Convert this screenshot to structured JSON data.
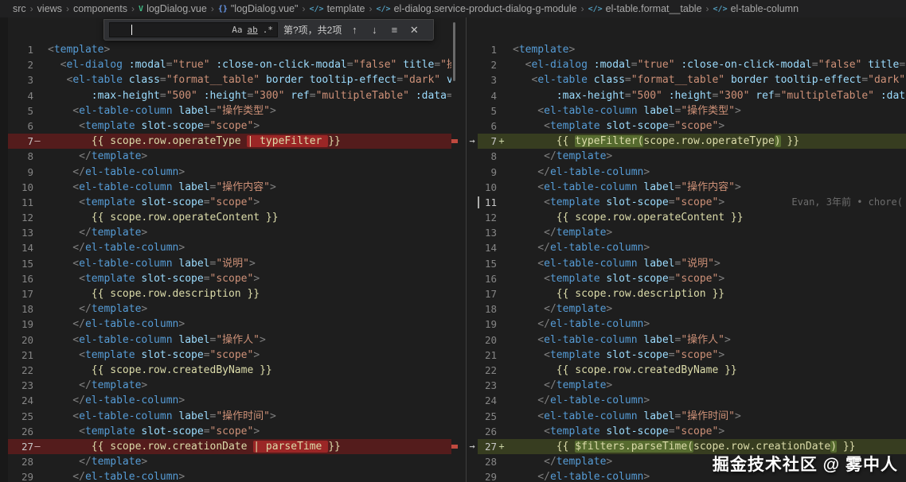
{
  "breadcrumb": {
    "separator": "›",
    "items": [
      {
        "label": "src",
        "icon": null
      },
      {
        "label": "views",
        "icon": null
      },
      {
        "label": "components",
        "icon": null
      },
      {
        "label": "logDialog.vue",
        "icon": "vue-icon"
      },
      {
        "label": "\"logDialog.vue\"",
        "icon": "braces-icon"
      },
      {
        "label": "template",
        "icon": "tag-icon"
      },
      {
        "label": "el-dialog.service-product-dialog-g-module",
        "icon": "tag-icon"
      },
      {
        "label": "el-table.format__table",
        "icon": "tag-icon"
      },
      {
        "label": "el-table-column",
        "icon": "tag-icon"
      }
    ]
  },
  "find_widget": {
    "input_value": "",
    "results_text": "第?项，共2项",
    "icons": {
      "match_case": "Aa",
      "whole_word": "ab",
      "regex": ".*",
      "prev": "↑",
      "next": "↓",
      "in_selection": "≡",
      "close": "✕"
    }
  },
  "colors": {
    "punct": "#808080",
    "tag": "#569cd6",
    "attr": "#9cdcfe",
    "string": "#ce9178",
    "expr": "#dcdcaa",
    "text": "#d4d4d4",
    "line_number": "#858585",
    "removed_line": "#541c1c",
    "removed_word": "#9b2626",
    "added_line": "#373d20",
    "added_word": "#566b2f"
  },
  "editor": {
    "cursor_line": 11,
    "diff_arrow": "→",
    "blame": {
      "line": 11,
      "text": "Evan, 3年前 • chore("
    },
    "lines": [
      {
        "n": 1,
        "segs": [
          [
            "p",
            "<"
          ],
          [
            "tag",
            "template"
          ],
          [
            "p",
            ">"
          ]
        ]
      },
      {
        "n": 2,
        "segs": [
          [
            "p",
            "  <"
          ],
          [
            "tag",
            "el-dialog"
          ],
          [
            "d",
            " "
          ],
          [
            "at",
            ":modal"
          ],
          [
            "p",
            "="
          ],
          [
            "st",
            "\"true\""
          ],
          [
            "d",
            " "
          ],
          [
            "at",
            ":close-on-click-modal"
          ],
          [
            "p",
            "="
          ],
          [
            "st",
            "\"false\""
          ],
          [
            "d",
            " "
          ],
          [
            "at",
            "title"
          ],
          [
            "p",
            "="
          ],
          [
            "st",
            "\"操"
          ]
        ]
      },
      {
        "n": 3,
        "segs": [
          [
            "p",
            "   <"
          ],
          [
            "tag",
            "el-table"
          ],
          [
            "d",
            " "
          ],
          [
            "at",
            "class"
          ],
          [
            "p",
            "="
          ],
          [
            "st",
            "\"format__table\""
          ],
          [
            "d",
            " "
          ],
          [
            "at",
            "border"
          ],
          [
            "d",
            " "
          ],
          [
            "at",
            "tooltip-effect"
          ],
          [
            "p",
            "="
          ],
          [
            "st",
            "\"dark\""
          ],
          [
            "d",
            " "
          ],
          [
            "at",
            "v-"
          ]
        ]
      },
      {
        "n": 4,
        "segs": [
          [
            "at",
            "       :max-height"
          ],
          [
            "p",
            "="
          ],
          [
            "st",
            "\"500\""
          ],
          [
            "d",
            " "
          ],
          [
            "at",
            ":height"
          ],
          [
            "p",
            "="
          ],
          [
            "st",
            "\"300\""
          ],
          [
            "d",
            " "
          ],
          [
            "at",
            "ref"
          ],
          [
            "p",
            "="
          ],
          [
            "st",
            "\"multipleTable\""
          ],
          [
            "d",
            " "
          ],
          [
            "at",
            ":data"
          ],
          [
            "p",
            "="
          ],
          [
            "st",
            "\""
          ]
        ]
      },
      {
        "n": 5,
        "segs": [
          [
            "p",
            "    <"
          ],
          [
            "tag",
            "el-table-column"
          ],
          [
            "d",
            " "
          ],
          [
            "at",
            "label"
          ],
          [
            "p",
            "="
          ],
          [
            "st",
            "\"操作类型\""
          ],
          [
            "p",
            ">"
          ]
        ]
      },
      {
        "n": 6,
        "segs": [
          [
            "p",
            "     <"
          ],
          [
            "tag",
            "template"
          ],
          [
            "d",
            " "
          ],
          [
            "at",
            "slot-scope"
          ],
          [
            "p",
            "="
          ],
          [
            "st",
            "\"scope\""
          ],
          [
            "p",
            ">"
          ]
        ]
      },
      {
        "n": 7,
        "left": {
          "type": "removed",
          "marker": "–",
          "segs": [
            [
              "ex",
              "       {{ scope.row.operateType "
            ],
            [
              "ex hr",
              "| typeFilter "
            ],
            [
              "ex",
              "}}"
            ]
          ]
        },
        "right": {
          "type": "added",
          "marker": "+",
          "arrow": true,
          "segs": [
            [
              "ex",
              "       {{ "
            ],
            [
              "ex hg",
              "typeFilter("
            ],
            [
              "ex",
              "scope.row.operateType"
            ],
            [
              "ex hg",
              ")"
            ],
            [
              "ex",
              " }}"
            ]
          ]
        }
      },
      {
        "n": 8,
        "segs": [
          [
            "p",
            "     </"
          ],
          [
            "tag",
            "template"
          ],
          [
            "p",
            ">"
          ]
        ]
      },
      {
        "n": 9,
        "segs": [
          [
            "p",
            "    </"
          ],
          [
            "tag",
            "el-table-column"
          ],
          [
            "p",
            ">"
          ]
        ]
      },
      {
        "n": 10,
        "segs": [
          [
            "p",
            "    <"
          ],
          [
            "tag",
            "el-table-column"
          ],
          [
            "d",
            " "
          ],
          [
            "at",
            "label"
          ],
          [
            "p",
            "="
          ],
          [
            "st",
            "\"操作内容\""
          ],
          [
            "p",
            ">"
          ]
        ]
      },
      {
        "n": 11,
        "segs": [
          [
            "p",
            "     <"
          ],
          [
            "tag",
            "template"
          ],
          [
            "d",
            " "
          ],
          [
            "at",
            "slot-scope"
          ],
          [
            "p",
            "="
          ],
          [
            "st",
            "\"scope\""
          ],
          [
            "p",
            ">"
          ]
        ]
      },
      {
        "n": 12,
        "segs": [
          [
            "ex",
            "       {{ scope.row.operateContent }}"
          ]
        ]
      },
      {
        "n": 13,
        "segs": [
          [
            "p",
            "     </"
          ],
          [
            "tag",
            "template"
          ],
          [
            "p",
            ">"
          ]
        ]
      },
      {
        "n": 14,
        "segs": [
          [
            "p",
            "    </"
          ],
          [
            "tag",
            "el-table-column"
          ],
          [
            "p",
            ">"
          ]
        ]
      },
      {
        "n": 15,
        "segs": [
          [
            "p",
            "    <"
          ],
          [
            "tag",
            "el-table-column"
          ],
          [
            "d",
            " "
          ],
          [
            "at",
            "label"
          ],
          [
            "p",
            "="
          ],
          [
            "st",
            "\"说明\""
          ],
          [
            "p",
            ">"
          ]
        ]
      },
      {
        "n": 16,
        "segs": [
          [
            "p",
            "     <"
          ],
          [
            "tag",
            "template"
          ],
          [
            "d",
            " "
          ],
          [
            "at",
            "slot-scope"
          ],
          [
            "p",
            "="
          ],
          [
            "st",
            "\"scope\""
          ],
          [
            "p",
            ">"
          ]
        ]
      },
      {
        "n": 17,
        "segs": [
          [
            "ex",
            "       {{ scope.row.description }}"
          ]
        ]
      },
      {
        "n": 18,
        "segs": [
          [
            "p",
            "     </"
          ],
          [
            "tag",
            "template"
          ],
          [
            "p",
            ">"
          ]
        ]
      },
      {
        "n": 19,
        "segs": [
          [
            "p",
            "    </"
          ],
          [
            "tag",
            "el-table-column"
          ],
          [
            "p",
            ">"
          ]
        ]
      },
      {
        "n": 20,
        "segs": [
          [
            "p",
            "    <"
          ],
          [
            "tag",
            "el-table-column"
          ],
          [
            "d",
            " "
          ],
          [
            "at",
            "label"
          ],
          [
            "p",
            "="
          ],
          [
            "st",
            "\"操作人\""
          ],
          [
            "p",
            ">"
          ]
        ]
      },
      {
        "n": 21,
        "segs": [
          [
            "p",
            "     <"
          ],
          [
            "tag",
            "template"
          ],
          [
            "d",
            " "
          ],
          [
            "at",
            "slot-scope"
          ],
          [
            "p",
            "="
          ],
          [
            "st",
            "\"scope\""
          ],
          [
            "p",
            ">"
          ]
        ]
      },
      {
        "n": 22,
        "segs": [
          [
            "ex",
            "       {{ scope.row.createdByName }}"
          ]
        ]
      },
      {
        "n": 23,
        "segs": [
          [
            "p",
            "     </"
          ],
          [
            "tag",
            "template"
          ],
          [
            "p",
            ">"
          ]
        ]
      },
      {
        "n": 24,
        "segs": [
          [
            "p",
            "    </"
          ],
          [
            "tag",
            "el-table-column"
          ],
          [
            "p",
            ">"
          ]
        ]
      },
      {
        "n": 25,
        "segs": [
          [
            "p",
            "    <"
          ],
          [
            "tag",
            "el-table-column"
          ],
          [
            "d",
            " "
          ],
          [
            "at",
            "label"
          ],
          [
            "p",
            "="
          ],
          [
            "st",
            "\"操作时间\""
          ],
          [
            "p",
            ">"
          ]
        ]
      },
      {
        "n": 26,
        "segs": [
          [
            "p",
            "     <"
          ],
          [
            "tag",
            "template"
          ],
          [
            "d",
            " "
          ],
          [
            "at",
            "slot-scope"
          ],
          [
            "p",
            "="
          ],
          [
            "st",
            "\"scope\""
          ],
          [
            "p",
            ">"
          ]
        ]
      },
      {
        "n": 27,
        "left": {
          "type": "removed",
          "marker": "–",
          "segs": [
            [
              "ex",
              "       {{ scope.row.creationDate "
            ],
            [
              "ex hr",
              "| parseTime "
            ],
            [
              "ex",
              "}}"
            ]
          ]
        },
        "right": {
          "type": "added",
          "marker": "+",
          "arrow": true,
          "segs": [
            [
              "ex",
              "       {{ "
            ],
            [
              "ex hg",
              "$filters.parseTime("
            ],
            [
              "ex",
              "scope.row.creationDate"
            ],
            [
              "ex hg",
              ")"
            ],
            [
              "ex",
              " }}"
            ]
          ]
        }
      },
      {
        "n": 28,
        "segs": [
          [
            "p",
            "     </"
          ],
          [
            "tag",
            "template"
          ],
          [
            "p",
            ">"
          ]
        ]
      },
      {
        "n": 29,
        "segs": [
          [
            "p",
            "    </"
          ],
          [
            "tag",
            "el-table-column"
          ],
          [
            "p",
            ">"
          ]
        ]
      }
    ]
  },
  "watermark": "掘金技术社区 @ 雾中人"
}
